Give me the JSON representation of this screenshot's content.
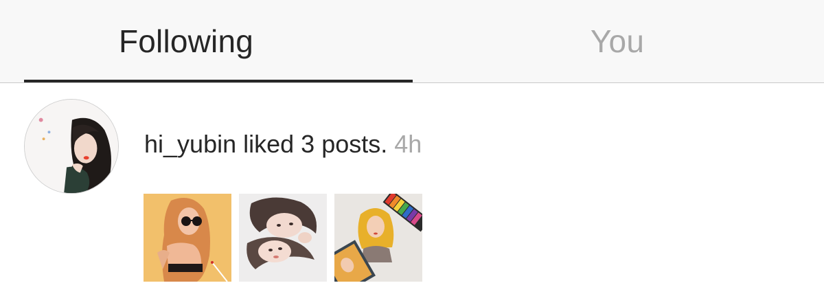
{
  "tabs": [
    {
      "label": "Following",
      "active": true
    },
    {
      "label": "You",
      "active": false
    }
  ],
  "colors": {
    "text": "#262626",
    "muted": "#a8a8a8",
    "tab_bar_bg": "#f8f8f8"
  },
  "activity": {
    "username": "hi_yubin",
    "action": "liked 3 posts.",
    "time": "4h",
    "avatar_icon": "user-avatar",
    "posts": [
      {
        "icon": "post-thumbnail-blonde-girl-sunglasses"
      },
      {
        "icon": "post-thumbnail-couple"
      },
      {
        "icon": "post-thumbnail-drawing-with-pastels"
      }
    ]
  }
}
